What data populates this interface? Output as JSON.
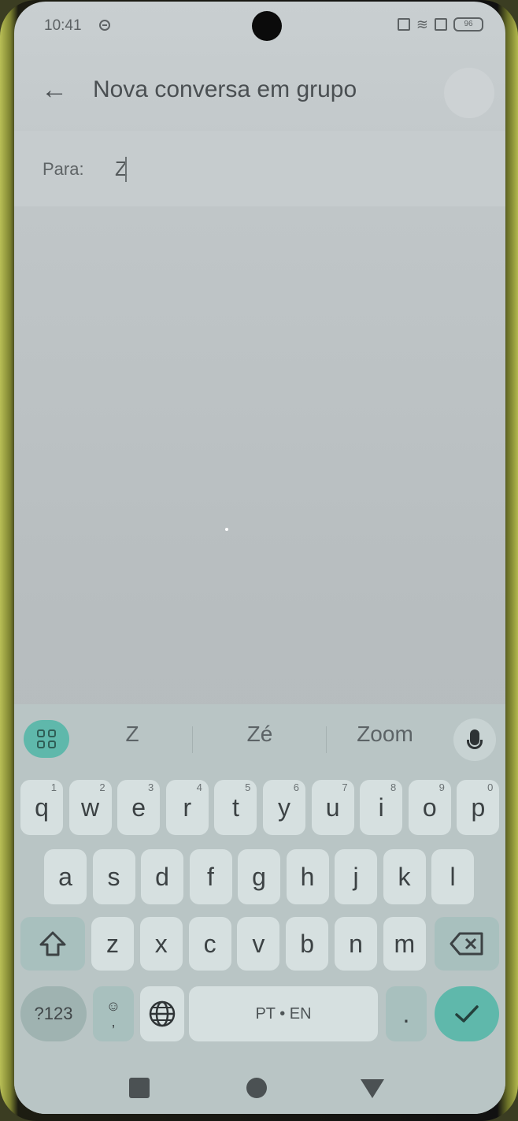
{
  "status_bar": {
    "time": "10:41",
    "battery": "96"
  },
  "header": {
    "back_icon": "arrow-left-icon",
    "title": "Nova conversa em grupo"
  },
  "recipient": {
    "label": "Para:",
    "value": "Z"
  },
  "keyboard": {
    "suggestions": [
      "Z",
      "Zé",
      "Zoom"
    ],
    "row1": [
      {
        "key": "q",
        "hint": "1"
      },
      {
        "key": "w",
        "hint": "2"
      },
      {
        "key": "e",
        "hint": "3"
      },
      {
        "key": "r",
        "hint": "4"
      },
      {
        "key": "t",
        "hint": "5"
      },
      {
        "key": "y",
        "hint": "6"
      },
      {
        "key": "u",
        "hint": "7"
      },
      {
        "key": "i",
        "hint": "8"
      },
      {
        "key": "o",
        "hint": "9"
      },
      {
        "key": "p",
        "hint": "0"
      }
    ],
    "row2": [
      "a",
      "s",
      "d",
      "f",
      "g",
      "h",
      "j",
      "k",
      "l"
    ],
    "row3": [
      "z",
      "x",
      "c",
      "v",
      "b",
      "n",
      "m"
    ],
    "symbols_key": "?123",
    "emoji_key_top": "☺",
    "emoji_key_bottom": ",",
    "space_label": "PT • EN",
    "period_key": ".",
    "accent_color": "#5fb8ab"
  },
  "nav": {
    "recents": "square-icon",
    "home": "circle-icon",
    "back": "triangle-icon"
  }
}
